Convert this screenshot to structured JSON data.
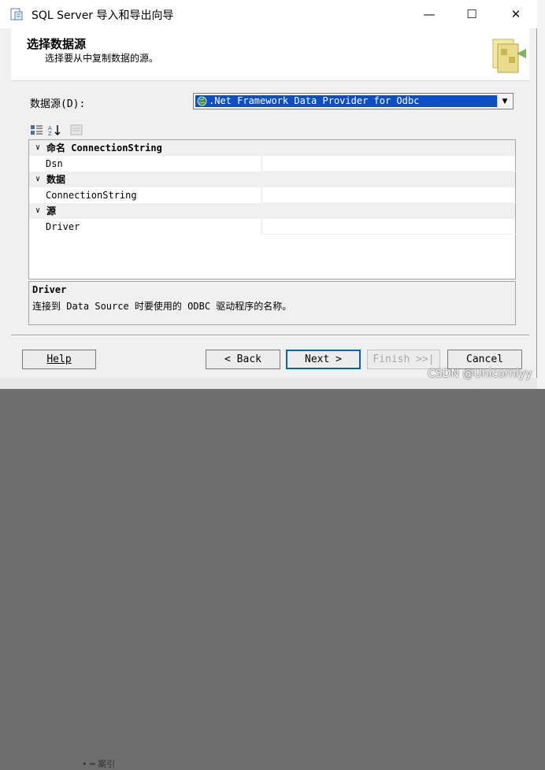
{
  "window": {
    "title": "SQL Server 导入和导出向导",
    "minimize": "—",
    "maximize": "☐",
    "close": "✕"
  },
  "header": {
    "title": "选择数据源",
    "subtitle": "选择要从中复制数据的源。"
  },
  "datasource": {
    "label": "数据源(D):",
    "selected": ".Net Framework Data Provider for Odbc"
  },
  "toolbar": {
    "items": [
      "categorized-icon",
      "alphabetical-icon",
      "property-pages-icon"
    ]
  },
  "grid": {
    "rows": [
      {
        "type": "category",
        "label": "命名 ConnectionString"
      },
      {
        "type": "property",
        "name": "Dsn",
        "value": ""
      },
      {
        "type": "category",
        "label": "数据"
      },
      {
        "type": "property",
        "name": "ConnectionString",
        "value": ""
      },
      {
        "type": "category",
        "label": "源"
      },
      {
        "type": "property",
        "name": "Driver",
        "value": ""
      }
    ]
  },
  "description": {
    "title": "Driver",
    "text": "连接到 Data Source 时要使用的 ODBC 驱动程序的名称。"
  },
  "buttons": {
    "help": "Help",
    "back": "< Back",
    "next": "Next >",
    "finish": "Finish >>|",
    "cancel": "Cancel"
  },
  "watermark": "CSDN @Unicornlyy",
  "bottom_fragment": "• ═ 案引",
  "colors": {
    "selection": "#0b4fc2",
    "default_button_border": "#0a64a4",
    "window_bg": "#f0f0f0"
  }
}
